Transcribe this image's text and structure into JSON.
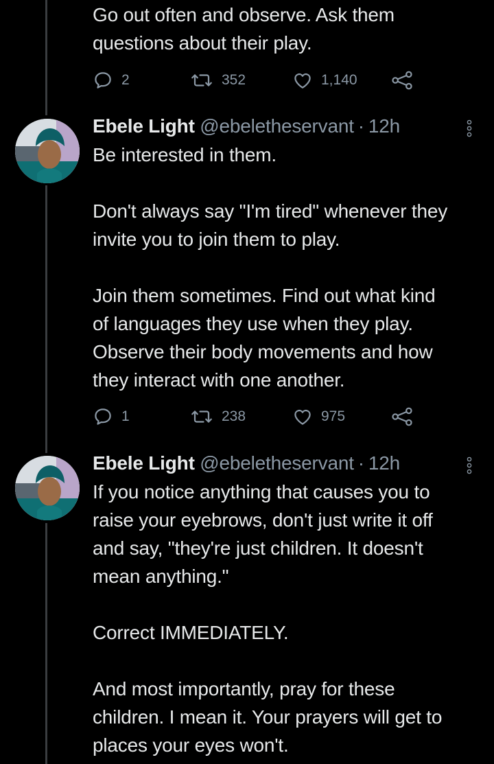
{
  "thread": {
    "top_tweet": {
      "text_lines": [
        "Go out often and observe. Ask them",
        "questions about their play."
      ],
      "actions": {
        "replies": "2",
        "retweets": "352",
        "likes": "1,140"
      }
    },
    "tweets": [
      {
        "name": "Ebele Light",
        "handle": "@ebeletheservant",
        "dot": "·",
        "time": "12h",
        "text": "Be interested in them.\n\nDon't always say \"I'm tired\" whenever they\ninvite you to join them to play.\n\nJoin them sometimes. Find out what kind\nof languages they use when they play.\nObserve their body movements and how\nthey interact with one another.",
        "actions": {
          "replies": "1",
          "retweets": "238",
          "likes": "975"
        }
      },
      {
        "name": "Ebele Light",
        "handle": "@ebeletheservant",
        "dot": "·",
        "time": "12h",
        "text": "If you notice anything that causes you to\nraise your eyebrows, don't just write it off\nand say, \"they're just children. It doesn't\nmean anything.\"\n\nCorrect IMMEDIATELY.\n\nAnd most importantly, pray for these\nchildren. I mean it. Your prayers will get to\nplaces your eyes won't."
      }
    ]
  },
  "icons": {
    "reply": "speech-bubble-icon",
    "retweet": "retweet-icon",
    "like": "heart-icon",
    "share": "share-icon",
    "more": "vertical-dots-icon"
  },
  "colors": {
    "background": "#000000",
    "text": "#e7e9ea",
    "secondary": "#8b98a5",
    "thread_line": "#3a3d40"
  }
}
